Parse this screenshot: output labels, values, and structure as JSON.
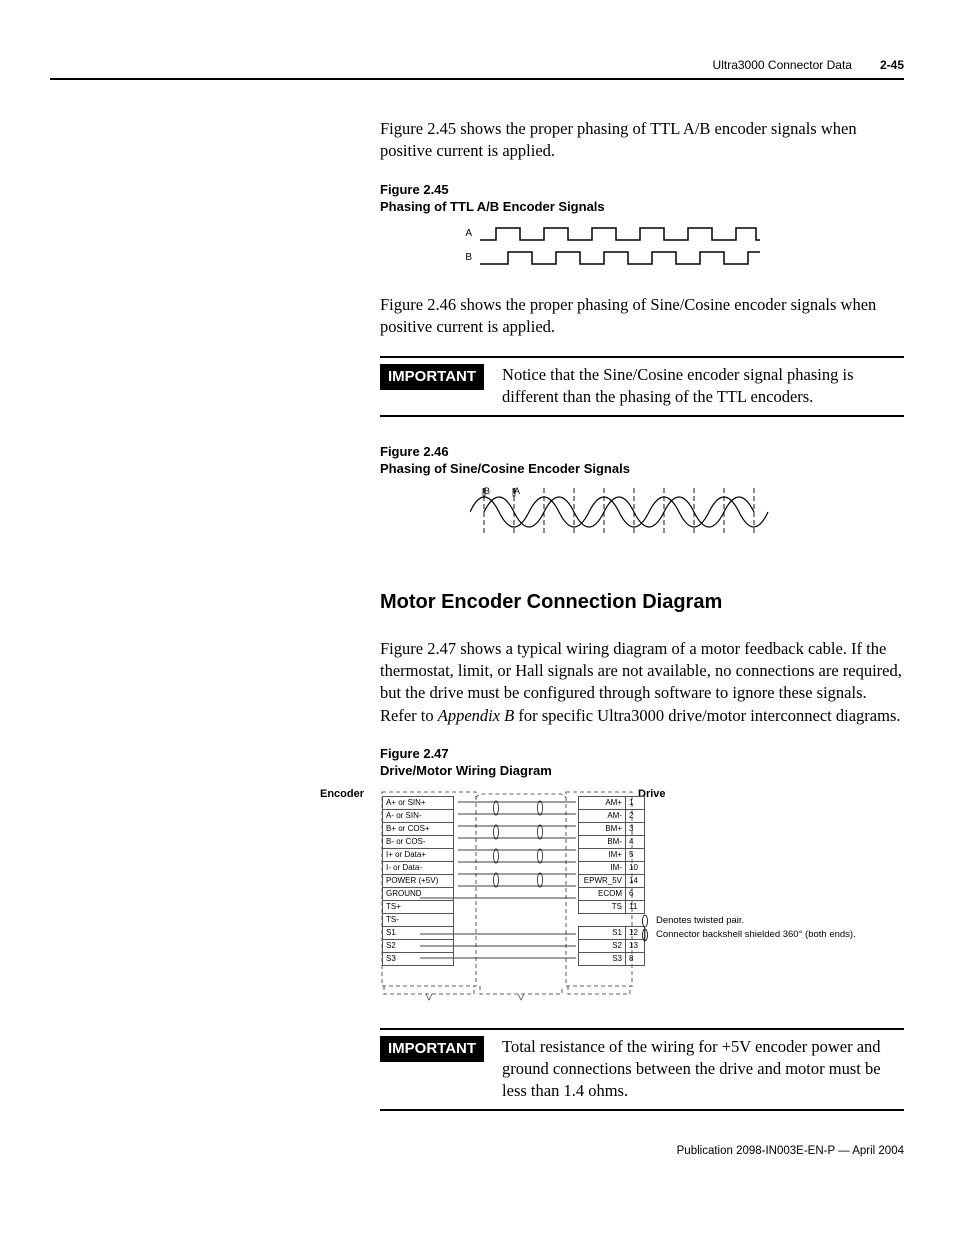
{
  "header": {
    "title": "Ultra3000 Connector Data",
    "page": "2-45"
  },
  "para1": "Figure 2.45 shows the proper phasing of TTL A/B encoder signals when positive current is applied.",
  "fig245": {
    "num": "Figure 2.45",
    "cap": "Phasing of TTL A/B Encoder Signals",
    "a": "A",
    "b": "B"
  },
  "para2": "Figure 2.46 shows the proper phasing of Sine/Cosine encoder signals when positive current is applied.",
  "imp1": {
    "tag": "IMPORTANT",
    "text": "Notice that the Sine/Cosine encoder signal phasing is different than the phasing of the TTL encoders."
  },
  "fig246": {
    "num": "Figure 2.46",
    "cap": "Phasing of Sine/Cosine Encoder Signals",
    "a": "A",
    "b": "B"
  },
  "section": "Motor Encoder Connection Diagram",
  "para3a": "Figure 2.47 shows a typical wiring diagram of a motor feedback cable. If the thermostat, limit, or Hall signals are not available, no connections are required, but the drive must be configured through software to ignore these signals. Refer to ",
  "para3b": "Appendix B",
  "para3c": " for specific Ultra3000 drive/motor interconnect diagrams.",
  "fig247": {
    "num": "Figure 2.47",
    "cap": "Drive/Motor Wiring Diagram",
    "encoder": "Encoder",
    "drive": "Drive"
  },
  "encoder_rows": [
    "A+ or SIN+",
    "A- or SIN-",
    "B+ or COS+",
    "B- or COS-",
    "I+ or Data+",
    "I- or Data-",
    "POWER (+5V)",
    "GROUND",
    "TS+",
    "TS-",
    "S1",
    "S2",
    "S3"
  ],
  "drive_rows": [
    {
      "name": "AM+",
      "pin": "1"
    },
    {
      "name": "AM-",
      "pin": "2"
    },
    {
      "name": "BM+",
      "pin": "3"
    },
    {
      "name": "BM-",
      "pin": "4"
    },
    {
      "name": "IM+",
      "pin": "5"
    },
    {
      "name": "IM-",
      "pin": "10"
    },
    {
      "name": "EPWR_5V",
      "pin": "14"
    },
    {
      "name": "ECOM",
      "pin": "6"
    },
    {
      "name": "TS",
      "pin": "11"
    },
    {
      "name": "",
      "pin": ""
    },
    {
      "name": "S1",
      "pin": "12"
    },
    {
      "name": "S2",
      "pin": "13"
    },
    {
      "name": "S3",
      "pin": "8"
    }
  ],
  "legend": {
    "l1": "Denotes twisted pair.",
    "l2": "Connector backshell shielded 360° (both ends)."
  },
  "imp2": {
    "tag": "IMPORTANT",
    "text": "Total resistance of the wiring for +5V encoder power and ground connections between the drive and motor must be less than 1.4 ohms."
  },
  "footer": "Publication 2098-IN003E-EN-P — April 2004"
}
